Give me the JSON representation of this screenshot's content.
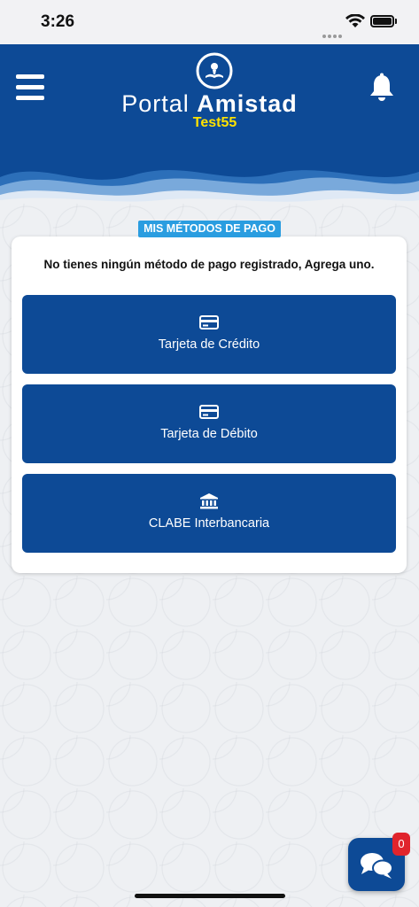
{
  "status_bar": {
    "time": "3:26",
    "icons": [
      "signal-dots-icon",
      "wifi-icon",
      "battery-icon"
    ]
  },
  "header": {
    "brand_light": "Portal",
    "brand_bold": "Amistad",
    "environment": "Test55",
    "menu_icon": "hamburger-menu-icon",
    "notifications_icon": "bell-icon",
    "logo_icon": "portal-amistad-logo-icon",
    "colors": {
      "primary": "#0d4a96",
      "accent": "#ffe200",
      "badge": "#2a9de0"
    }
  },
  "section": {
    "title": "MIS MÉTODOS DE PAGO",
    "empty_message": "No tienes ningún método de pago registrado, Agrega uno."
  },
  "methods": [
    {
      "label": "Tarjeta de Crédito",
      "icon": "credit-card-icon"
    },
    {
      "label": "Tarjeta de Débito",
      "icon": "debit-card-icon"
    },
    {
      "label": "CLABE Interbancaria",
      "icon": "bank-icon"
    }
  ],
  "chat": {
    "count": "0",
    "icon": "chat-bubbles-icon",
    "badge_color": "#e0242c"
  }
}
